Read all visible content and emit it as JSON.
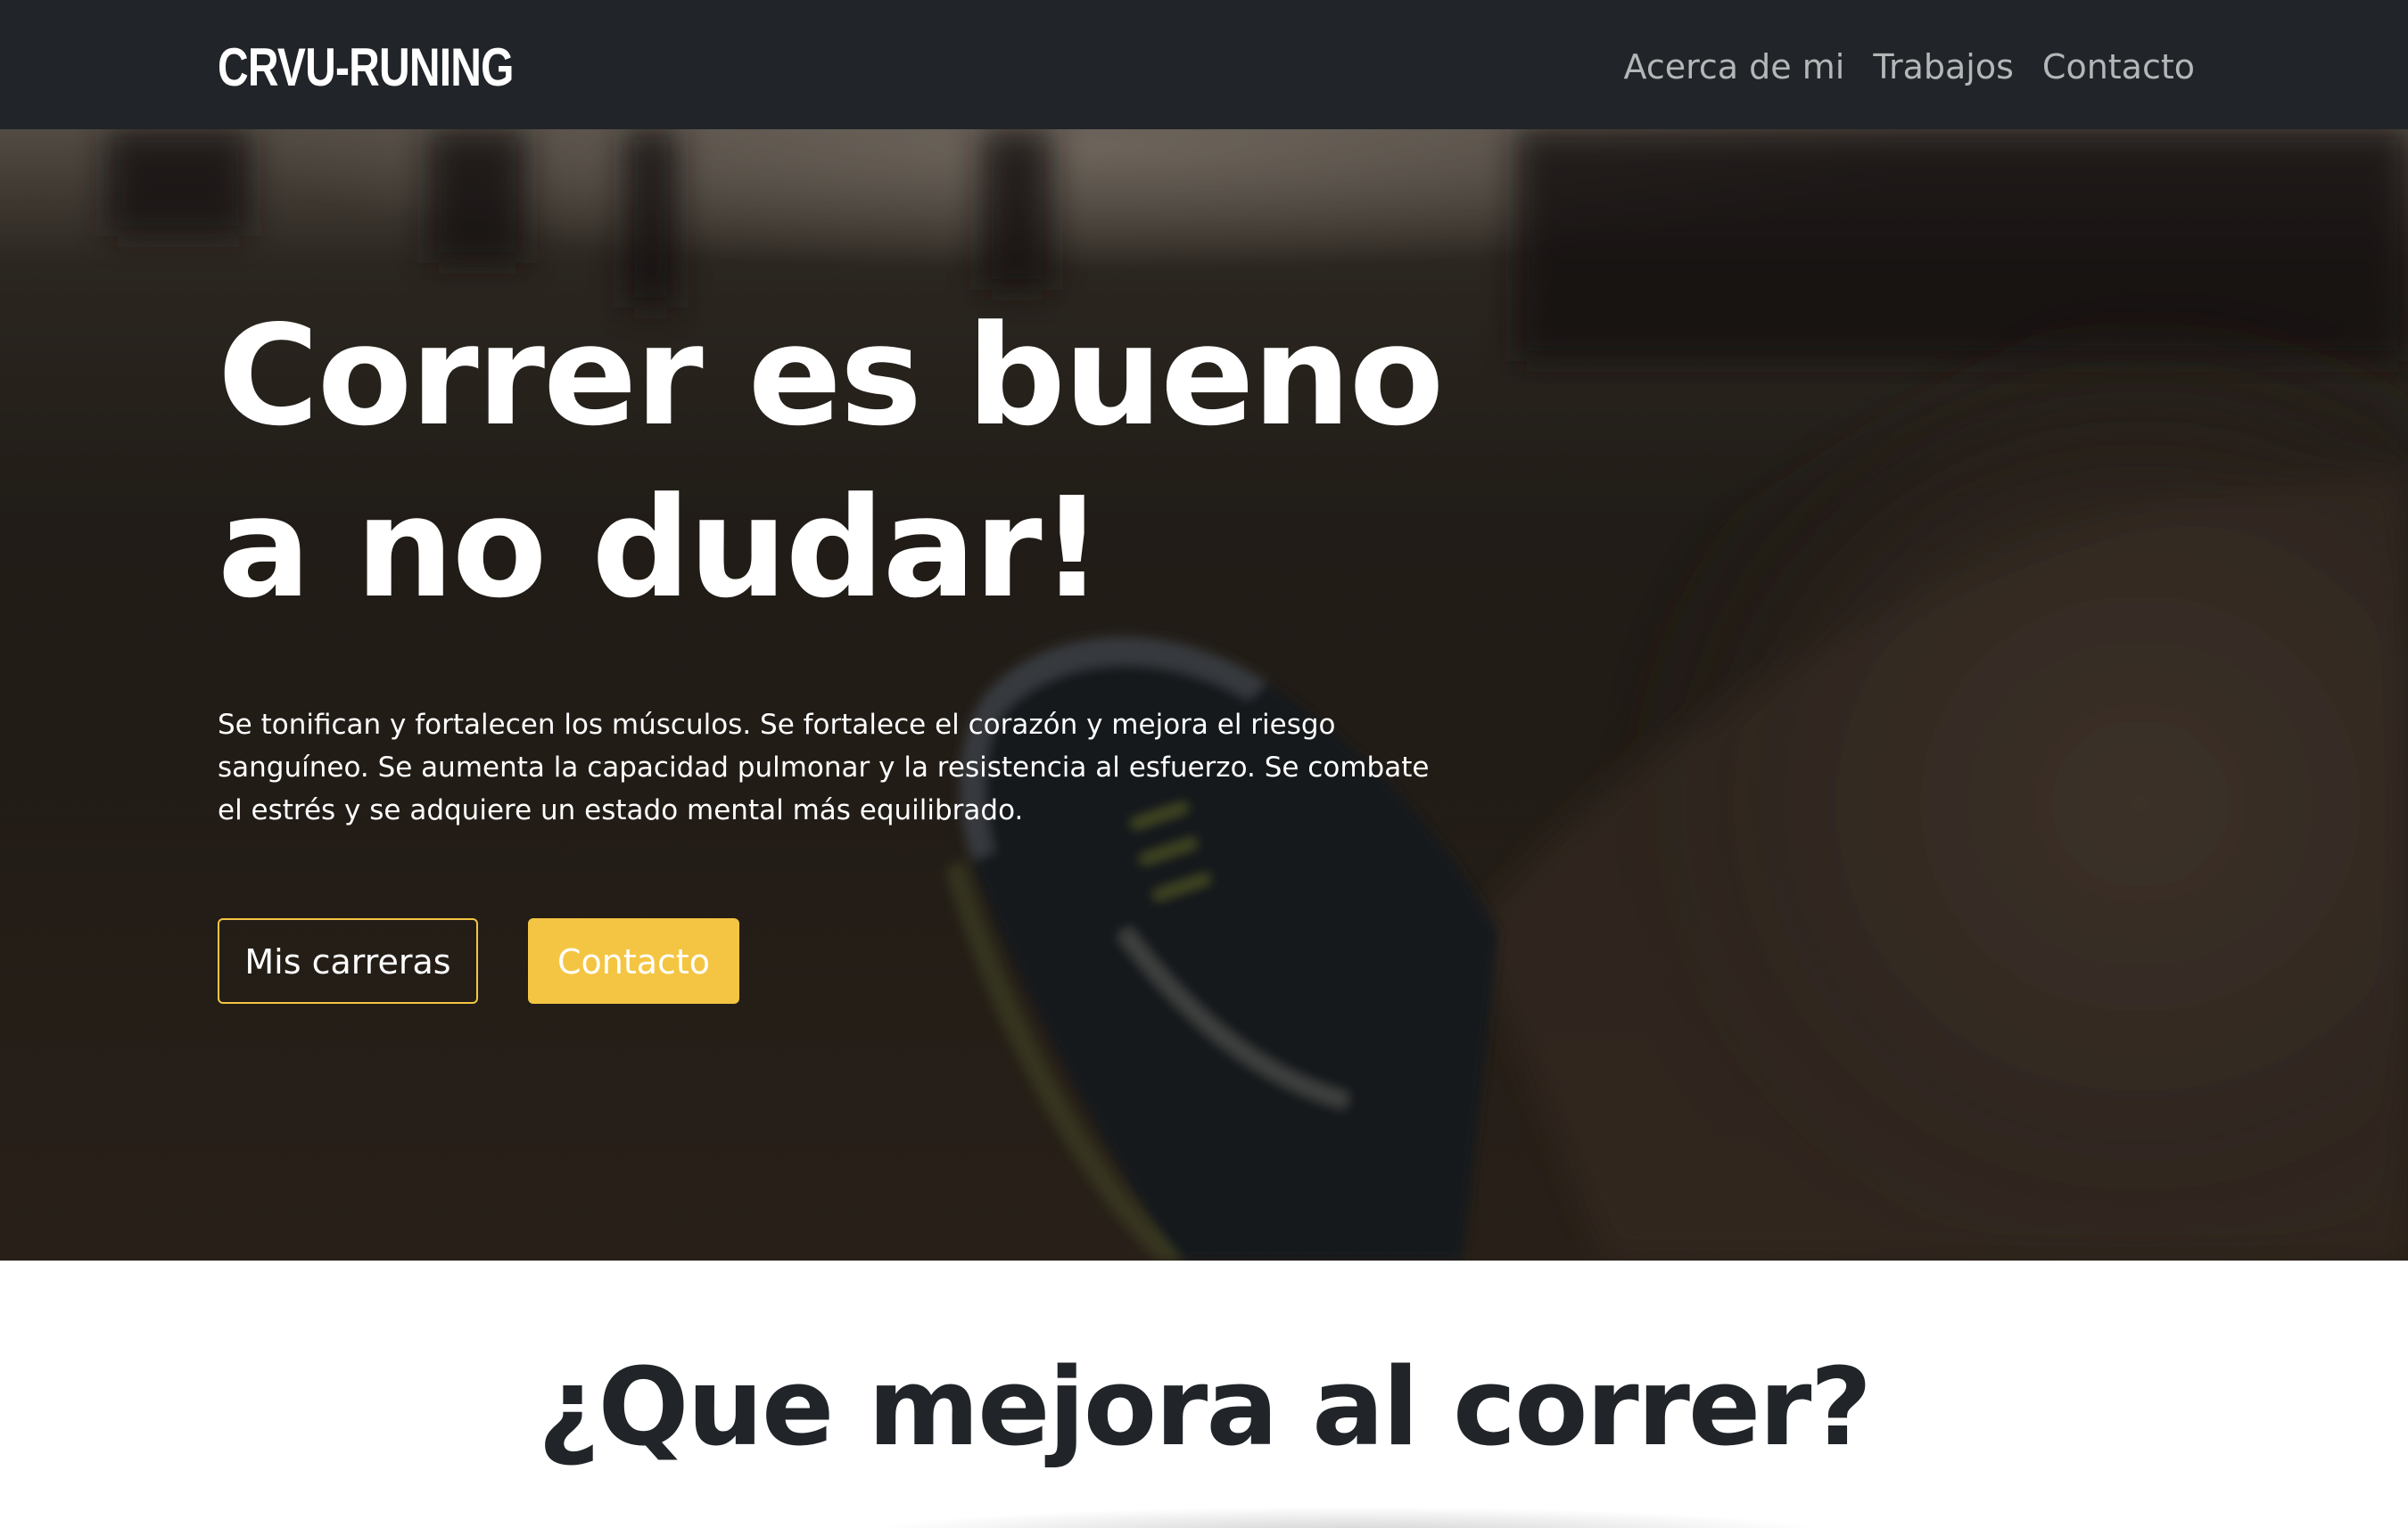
{
  "navbar": {
    "brand": "CRVU-RUNING",
    "links": [
      "Acerca de mi",
      "Trabajos",
      "Contacto"
    ]
  },
  "hero": {
    "headline": [
      "Correr es bueno",
      "a no dudar!"
    ],
    "description_lines": [
      "Se tonifican y fortalecen los músculos. Se fortalece el corazón y mejora el riesgo",
      "sanguíneo. Se aumenta la capacidad pulmonar y la resistencia al esfuerzo. Se combate",
      "el estrés y se adquiere un estado mental más equilibrado."
    ],
    "primary_button": "Mis carreras",
    "secondary_button": "Contacto"
  },
  "section": {
    "title": "¿Que mejora al correr?"
  },
  "colors": {
    "navbar_bg": "#212529",
    "accent": "#f4c543",
    "hero_overlay": "#2a241e",
    "heading_dark": "#212529"
  }
}
